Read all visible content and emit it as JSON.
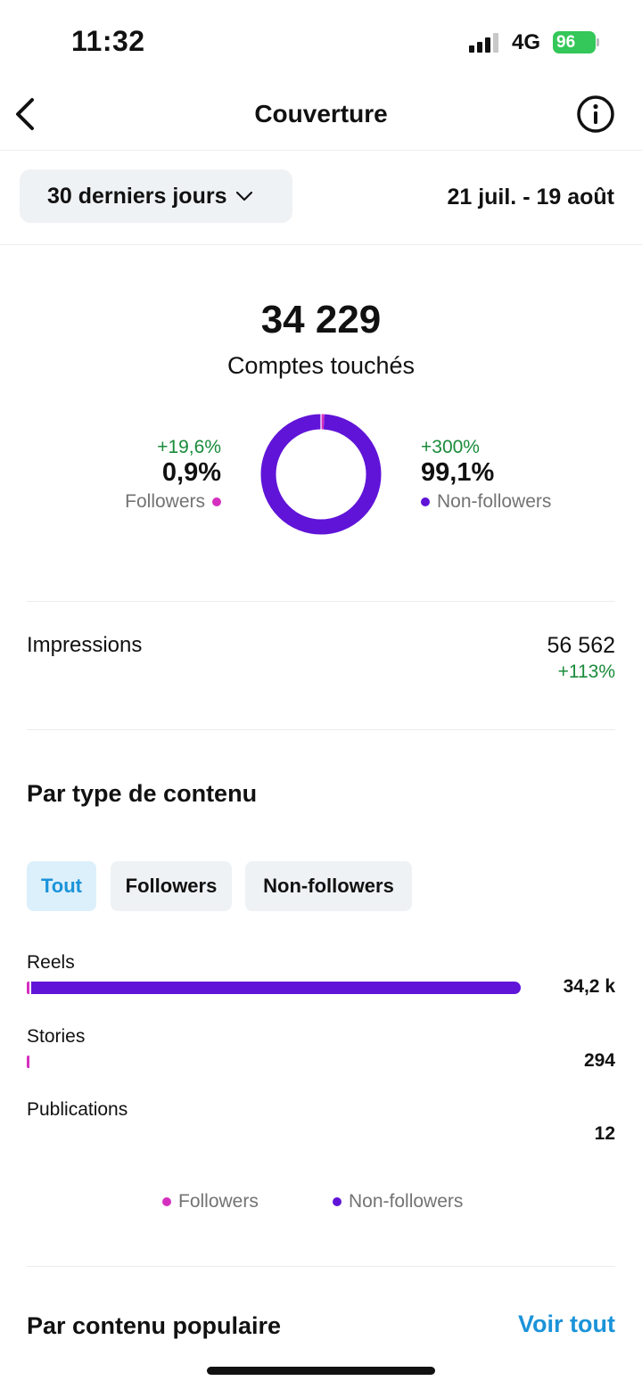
{
  "status_bar": {
    "time": "11:32",
    "network": "4G",
    "battery": "96"
  },
  "header": {
    "title": "Couverture",
    "back_icon": "chevron-left-icon",
    "info_icon": "info-circle-icon"
  },
  "range": {
    "selector_label": "30 derniers jours",
    "dates": "21 juil. - 19 août"
  },
  "reach": {
    "total": "34 229",
    "label": "Comptes touchés",
    "followers": {
      "change": "+19,6%",
      "percent": "0,9%",
      "label": "Followers",
      "share": 0.009
    },
    "non_followers": {
      "change": "+300%",
      "percent": "99,1%",
      "label": "Non-followers",
      "share": 0.991
    }
  },
  "impressions": {
    "label": "Impressions",
    "value": "56 562",
    "change": "+113%"
  },
  "content_type": {
    "title": "Par type de contenu",
    "filters": [
      "Tout",
      "Followers",
      "Non-followers"
    ],
    "active_filter": "Tout",
    "rows": [
      {
        "label": "Reels",
        "value": "34,2 k",
        "numeric": 34200
      },
      {
        "label": "Stories",
        "value": "294",
        "numeric": 294
      },
      {
        "label": "Publications",
        "value": "12",
        "numeric": 12
      }
    ],
    "legend": [
      "Followers",
      "Non-followers"
    ]
  },
  "popular": {
    "title": "Par contenu populaire",
    "link": "Voir tout"
  },
  "colors": {
    "followers": "#d52fc0",
    "non_followers": "#6014d8",
    "positive": "#1a8b3b",
    "link": "#1b93d9"
  }
}
